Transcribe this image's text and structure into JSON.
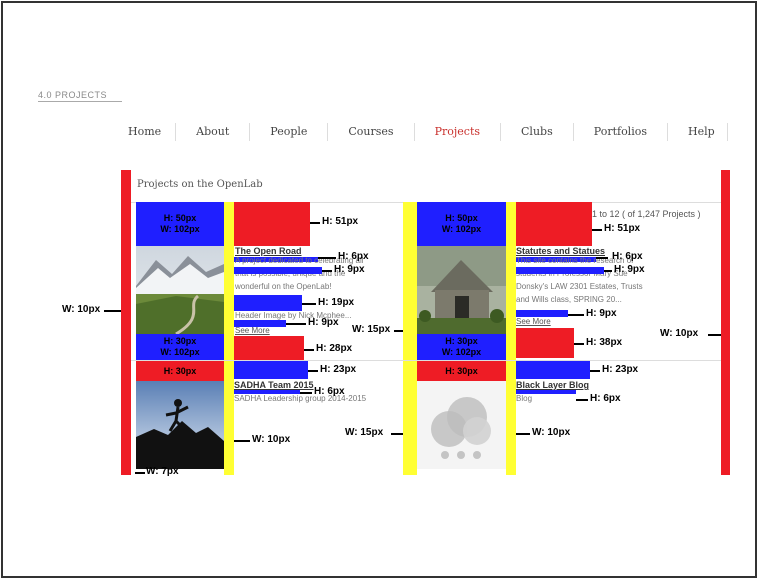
{
  "section": {
    "title": "4.0 PROJECTS"
  },
  "nav": {
    "items": [
      "Home",
      "About",
      "People",
      "Courses",
      "Projects",
      "Clubs",
      "Portfolios",
      "Help"
    ],
    "active": "Projects"
  },
  "panel": {
    "title": "Projects on the OpenLab",
    "count": "1 to 12 ( of 1,247 Projects )"
  },
  "projects": [
    {
      "title": "The Open Road",
      "desc_lines": [
        "A project dedicated to celebrating all",
        "that is possible, unique and the",
        "wonderful on the OpenLab!",
        "Header Image by Nick Mcphee..."
      ],
      "see_more": "See More",
      "image": "mountain-road-photo"
    },
    {
      "title": "Statutes and Statues",
      "desc_lines": [
        "This site contains the research of",
        "students in Professor Mary Sue",
        "Donsky's LAW 2301 Estates, Trusts",
        "and Wills class, SPRING 20..."
      ],
      "see_more": "See More",
      "image": "stone-building-photo"
    },
    {
      "title": "SADHA Team 2015",
      "desc_lines": [
        "SADHA Leadership group 2014-2015"
      ],
      "image": "climber-silhouette-photo"
    },
    {
      "title": "Black Layer Blog",
      "desc_lines": [
        "Blog"
      ],
      "image": "group-placeholder-avatar"
    }
  ],
  "annotations": {
    "h50w102": [
      "H:  50px",
      "W: 102px"
    ],
    "h30w102": [
      "H:  30px",
      "W: 102px"
    ],
    "h30": "H:  30px",
    "h51": "H: 51px",
    "h51b": "H:  51px",
    "h6": "H:  6px",
    "h9": "H: 9px",
    "h9b": "H:  9px",
    "h19": "H: 19px",
    "h28": "H:  28px",
    "h38": "H:  38px",
    "h23": "H:  23px",
    "h6b": "H:  6px",
    "h6c": "H:  6px",
    "w10": "W: 10px",
    "w15": "W: 15px",
    "w7": "W: 7px"
  },
  "colors": {
    "red": "#ee1c25",
    "blue": "#1f1fff",
    "yellow": "#ffff33",
    "active_nav": "#c9302c"
  }
}
